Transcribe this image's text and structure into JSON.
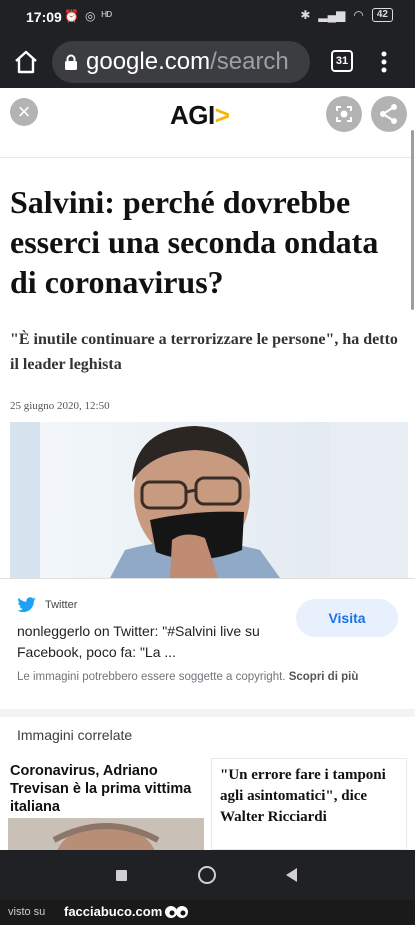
{
  "status_bar": {
    "time": "17:09",
    "battery": "42"
  },
  "browser": {
    "domain": "google.com",
    "path": "/search",
    "tab_count": "31"
  },
  "site": {
    "logo": "AGI",
    "logo_chevron": ">"
  },
  "article": {
    "title": "Salvini: perché dovrebbe esserci una seconda ondata di coronavirus?",
    "subtitle": "\"È inutile continuare a terrorizzare le persone\", ha detto il leader leghista",
    "date": "25 giugno 2020, 12:50"
  },
  "image_result": {
    "source": "Twitter",
    "title": "nonleggerlo on Twitter: \"#Salvini live su Facebook, poco fa: \"La ...",
    "visit_label": "Visita",
    "copyright_text": "Le immagini potrebbero essere soggette a copyright.",
    "copyright_link": "Scopri di più"
  },
  "related": {
    "heading": "Immagini correlate",
    "items": [
      {
        "title": "Coronavirus, Adriano Trevisan è la prima vittima italiana"
      },
      {
        "title": "\"Un errore fare i tamponi agli asintomatici\", dice Walter Ricciardi"
      }
    ]
  },
  "watermark": {
    "prefix": "visto su",
    "site": "facciabuco.com"
  },
  "colors": {
    "chrome_dark": "#202124",
    "accent_blue": "#1a73e8",
    "agi_yellow": "#f2b705"
  }
}
